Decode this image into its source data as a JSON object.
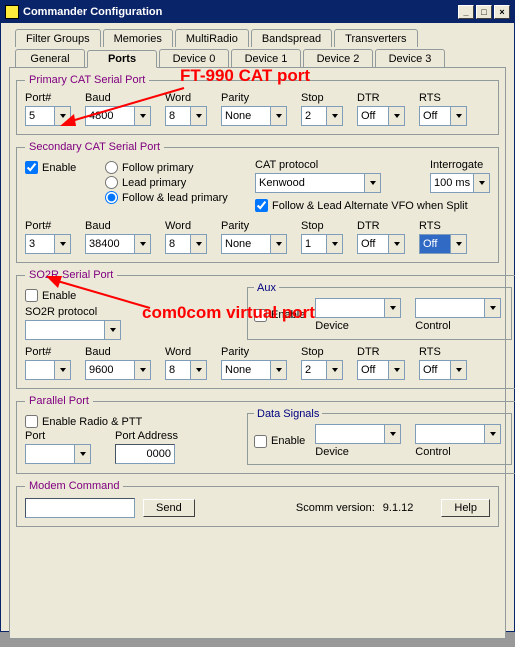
{
  "window": {
    "title": "Commander Configuration"
  },
  "tabs_top": [
    "Filter Groups",
    "Memories",
    "MultiRadio",
    "Bandspread",
    "Transverters"
  ],
  "tabs_bottom": [
    "General",
    "Ports",
    "Device 0",
    "Device 1",
    "Device 2",
    "Device 3"
  ],
  "active_tab": "Ports",
  "annotations": {
    "a1": "FT-990 CAT port",
    "a2": "com0com virtual port"
  },
  "primary": {
    "legend": "Primary CAT Serial Port",
    "labels": {
      "port": "Port#",
      "baud": "Baud",
      "word": "Word",
      "parity": "Parity",
      "stop": "Stop",
      "dtr": "DTR",
      "rts": "RTS"
    },
    "values": {
      "port": "5",
      "baud": "4800",
      "word": "8",
      "parity": "None",
      "stop": "2",
      "dtr": "Off",
      "rts": "Off"
    }
  },
  "secondary": {
    "legend": "Secondary CAT Serial Port",
    "enable_label": "Enable",
    "enable_checked": true,
    "radios": {
      "follow_primary": "Follow primary",
      "lead_primary": "Lead primary",
      "follow_lead": "Follow & lead primary"
    },
    "radio_selected": "follow_lead",
    "cat_protocol_label": "CAT protocol",
    "cat_protocol_value": "Kenwood",
    "interrogate_label": "Interrogate",
    "interrogate_value": "100 ms",
    "split_label": "Follow & Lead Alternate VFO when Split",
    "split_checked": true,
    "labels": {
      "port": "Port#",
      "baud": "Baud",
      "word": "Word",
      "parity": "Parity",
      "stop": "Stop",
      "dtr": "DTR",
      "rts": "RTS"
    },
    "values": {
      "port": "3",
      "baud": "38400",
      "word": "8",
      "parity": "None",
      "stop": "1",
      "dtr": "Off",
      "rts": "Off"
    }
  },
  "so2r": {
    "legend": "SO2R Serial Port",
    "enable_label": "Enable",
    "enable_checked": false,
    "protocol_label": "SO2R protocol",
    "protocol_value": "",
    "aux": {
      "legend": "Aux",
      "enable_label": "Enable",
      "enable_checked": false,
      "device_label": "Device",
      "control_label": "Control",
      "device_value": "",
      "control_value": ""
    },
    "labels": {
      "port": "Port#",
      "baud": "Baud",
      "word": "Word",
      "parity": "Parity",
      "stop": "Stop",
      "dtr": "DTR",
      "rts": "RTS"
    },
    "values": {
      "port": "",
      "baud": "9600",
      "word": "8",
      "parity": "None",
      "stop": "2",
      "dtr": "Off",
      "rts": "Off"
    }
  },
  "parallel": {
    "legend": "Parallel Port",
    "enable_label": "Enable Radio & PTT",
    "enable_checked": false,
    "port_label": "Port",
    "port_value": "",
    "addr_label": "Port Address",
    "addr_value": "0000",
    "data_signals": {
      "legend": "Data Signals",
      "enable_label": "Enable",
      "enable_checked": false,
      "device_label": "Device",
      "control_label": "Control",
      "device_value": "",
      "control_value": ""
    }
  },
  "modem": {
    "legend": "Modem Command",
    "input_value": "",
    "send": "Send",
    "version_label": "Scomm version:",
    "version_value": "9.1.12",
    "help": "Help"
  }
}
